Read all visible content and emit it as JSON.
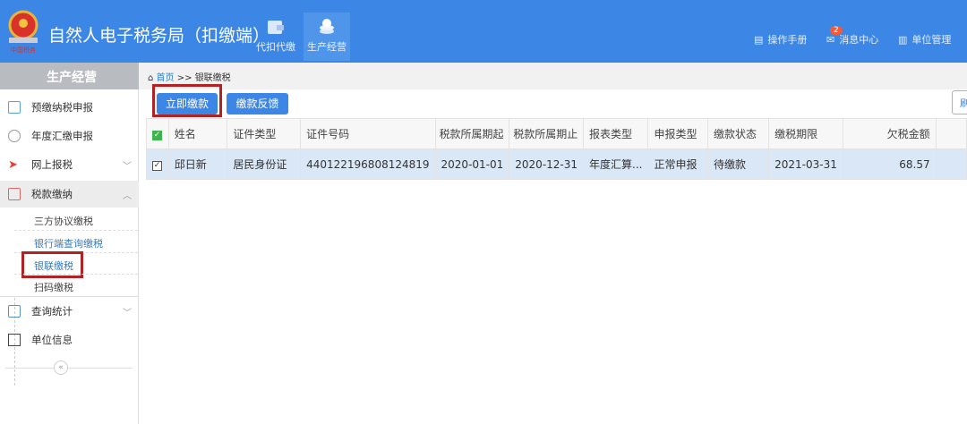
{
  "header": {
    "title": "自然人电子税务局（扣缴端）",
    "nav": [
      {
        "label": "代扣代缴",
        "icon": "wallet-icon"
      },
      {
        "label": "生产经营",
        "icon": "coins-icon",
        "active": true
      }
    ],
    "tools": [
      {
        "label": "操作手册",
        "icon": "document-icon"
      },
      {
        "label": "消息中心",
        "icon": "mail-icon",
        "badge": "2"
      },
      {
        "label": "单位管理",
        "icon": "building-icon"
      }
    ]
  },
  "sidebar": {
    "title": "生产经营",
    "items": [
      {
        "label": "预缴纳税申报"
      },
      {
        "label": "年度汇缴申报"
      },
      {
        "label": "网上报税"
      },
      {
        "label": "税款缴纳"
      },
      {
        "label": "查询统计"
      },
      {
        "label": "单位信息"
      }
    ],
    "sub_items": [
      {
        "label": "三方协议缴税"
      },
      {
        "label": "银行端查询缴税"
      },
      {
        "label": "银联缴税"
      },
      {
        "label": "扫码缴税"
      }
    ],
    "collapse": "«"
  },
  "breadcrumb": {
    "home": "首页",
    "sep": ">>",
    "current": "银联缴税"
  },
  "toolbar": {
    "pay_now": "立即缴款",
    "feedback": "缴款反馈",
    "refresh": "刷"
  },
  "table": {
    "headers": [
      "姓名",
      "证件类型",
      "证件号码",
      "税款所属期起",
      "税款所属期止",
      "报表类型",
      "申报类型",
      "缴款状态",
      "缴税期限",
      "欠税金额"
    ],
    "rows": [
      [
        "邱日新",
        "居民身份证",
        "440122196808124819",
        "2020-01-01",
        "2020-12-31",
        "年度汇算...",
        "正常申报",
        "待缴款",
        "2021-03-31",
        "68.57"
      ]
    ]
  },
  "colors": {
    "header": "#3c87e6",
    "highlight": "#b32222"
  }
}
